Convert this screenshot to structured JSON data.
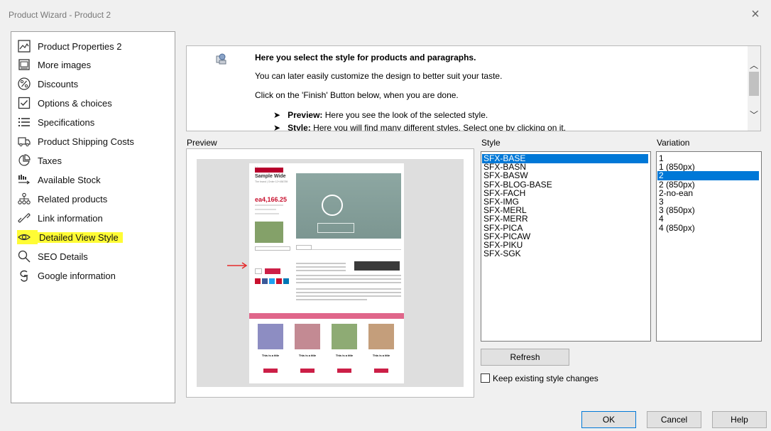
{
  "window": {
    "title": "Product Wizard - Product 2",
    "close_glyph": "×"
  },
  "sidebar": {
    "items": [
      {
        "label": "Product Properties 2",
        "icon": "image-icon"
      },
      {
        "label": "More images",
        "icon": "images-icon"
      },
      {
        "label": "Discounts",
        "icon": "percent-icon"
      },
      {
        "label": "Options & choices",
        "icon": "checkbox-icon"
      },
      {
        "label": "Specifications",
        "icon": "list-icon"
      },
      {
        "label": "Product Shipping Costs",
        "icon": "truck-icon"
      },
      {
        "label": "Taxes",
        "icon": "pie-chart-icon"
      },
      {
        "label": "Available Stock",
        "icon": "stock-icon"
      },
      {
        "label": "Related products",
        "icon": "hierarchy-icon"
      },
      {
        "label": "Link information",
        "icon": "link-icon"
      },
      {
        "label": "Detailed View Style",
        "icon": "eye-icon",
        "selected": true
      },
      {
        "label": "SEO Details",
        "icon": "search-icon"
      },
      {
        "label": "Google information",
        "icon": "google-icon"
      }
    ],
    "highlight_color": "#fffc35"
  },
  "info": {
    "heading": "Here you select the style for products and paragraphs.",
    "line1": "You can later easily customize the design to better suit your taste.",
    "line2": "Click on the 'Finish' Button below, when you are done.",
    "bullet1_term": "Preview:",
    "bullet1_text": "Here you see the look of the selected style.",
    "bullet2_term": "Style:",
    "bullet2_text": "Here you will find many different styles. Select one by clicking on it."
  },
  "labels": {
    "preview": "Preview",
    "style": "Style",
    "variation": "Variation"
  },
  "preview_page": {
    "badge": "On special",
    "title": "Sample Wide",
    "subtitle": "The brand  |  Order 12+456789",
    "price": "ea4,166.25",
    "related_header": "Related Products",
    "related_title": "This is a title"
  },
  "style_list": {
    "items": [
      "SFX-BASE",
      "SFX-BASN",
      "SFX-BASW",
      "SFX-BLOG-BASE",
      "SFX-FACH",
      "SFX-IMG",
      "SFX-MERL",
      "SFX-MERR",
      "SFX-PICA",
      "SFX-PICAW",
      "SFX-PIKU",
      "SFX-SGK"
    ],
    "selected_index": 0
  },
  "variation_list": {
    "items": [
      "1",
      "1 (850px)",
      "2",
      "2 (850px)",
      "2-no-ean",
      "3",
      "3 (850px)",
      "4",
      "4 (850px)"
    ],
    "selected_index": 2
  },
  "buttons": {
    "refresh": "Refresh",
    "ok": "OK",
    "cancel": "Cancel",
    "help": "Help"
  },
  "keep_changes": {
    "label": "Keep existing style changes",
    "checked": false
  },
  "colors": {
    "selection": "#0078d7",
    "accent_red": "#cc1f47"
  }
}
